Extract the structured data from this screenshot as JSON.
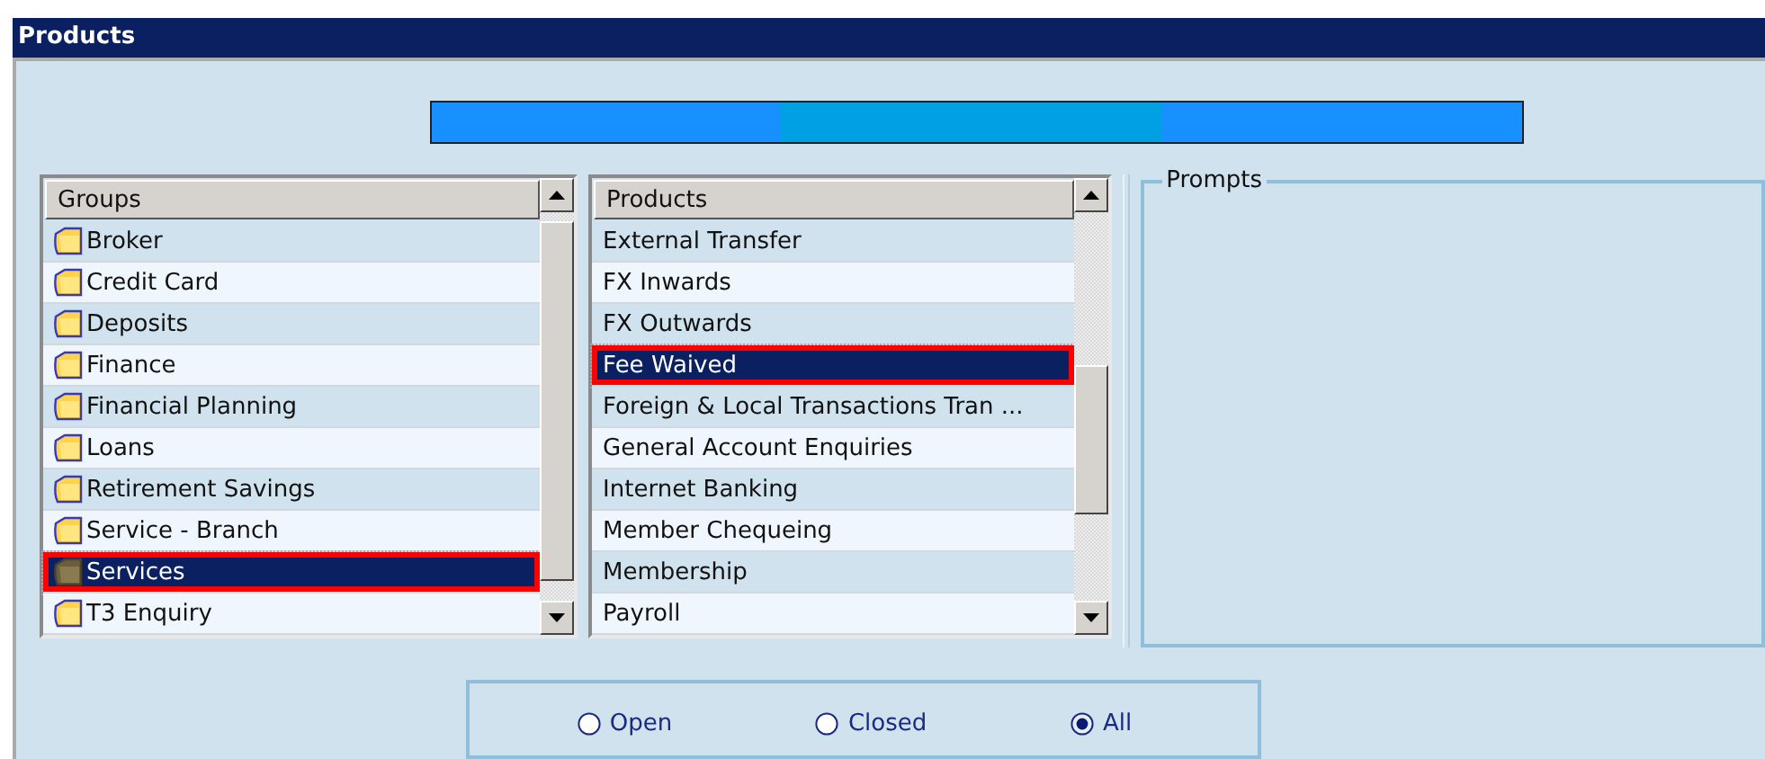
{
  "window": {
    "title": "Products"
  },
  "groups": {
    "header": "Groups",
    "items": [
      {
        "label": "Broker",
        "selected": false,
        "highlighted": false
      },
      {
        "label": "Credit Card",
        "selected": false,
        "highlighted": false
      },
      {
        "label": "Deposits",
        "selected": false,
        "highlighted": false
      },
      {
        "label": "Finance",
        "selected": false,
        "highlighted": false
      },
      {
        "label": "Financial Planning",
        "selected": false,
        "highlighted": false
      },
      {
        "label": "Loans",
        "selected": false,
        "highlighted": false
      },
      {
        "label": "Retirement Savings",
        "selected": false,
        "highlighted": false
      },
      {
        "label": "Service - Branch",
        "selected": false,
        "highlighted": false
      },
      {
        "label": "Services",
        "selected": true,
        "highlighted": true
      },
      {
        "label": "T3 Enquiry",
        "selected": false,
        "highlighted": false
      }
    ]
  },
  "products": {
    "header": "Products",
    "items": [
      {
        "label": "External Transfer",
        "selected": false,
        "highlighted": false
      },
      {
        "label": "FX Inwards",
        "selected": false,
        "highlighted": false
      },
      {
        "label": "FX Outwards",
        "selected": false,
        "highlighted": false
      },
      {
        "label": "Fee Waived",
        "selected": true,
        "highlighted": true
      },
      {
        "label": "Foreign & Local Transactions Tran ...",
        "selected": false,
        "highlighted": false
      },
      {
        "label": "General Account Enquiries",
        "selected": false,
        "highlighted": false
      },
      {
        "label": "Internet Banking",
        "selected": false,
        "highlighted": false
      },
      {
        "label": "Member Chequeing",
        "selected": false,
        "highlighted": false
      },
      {
        "label": "Membership",
        "selected": false,
        "highlighted": false
      },
      {
        "label": "Payroll",
        "selected": false,
        "highlighted": false
      }
    ]
  },
  "progress": {
    "indeterminate": true
  },
  "prompts": {
    "title": "Prompts"
  },
  "filter": [
    {
      "label": "Open",
      "selected": false
    },
    {
      "label": "Closed",
      "selected": false
    },
    {
      "label": "All",
      "selected": true
    }
  ]
}
